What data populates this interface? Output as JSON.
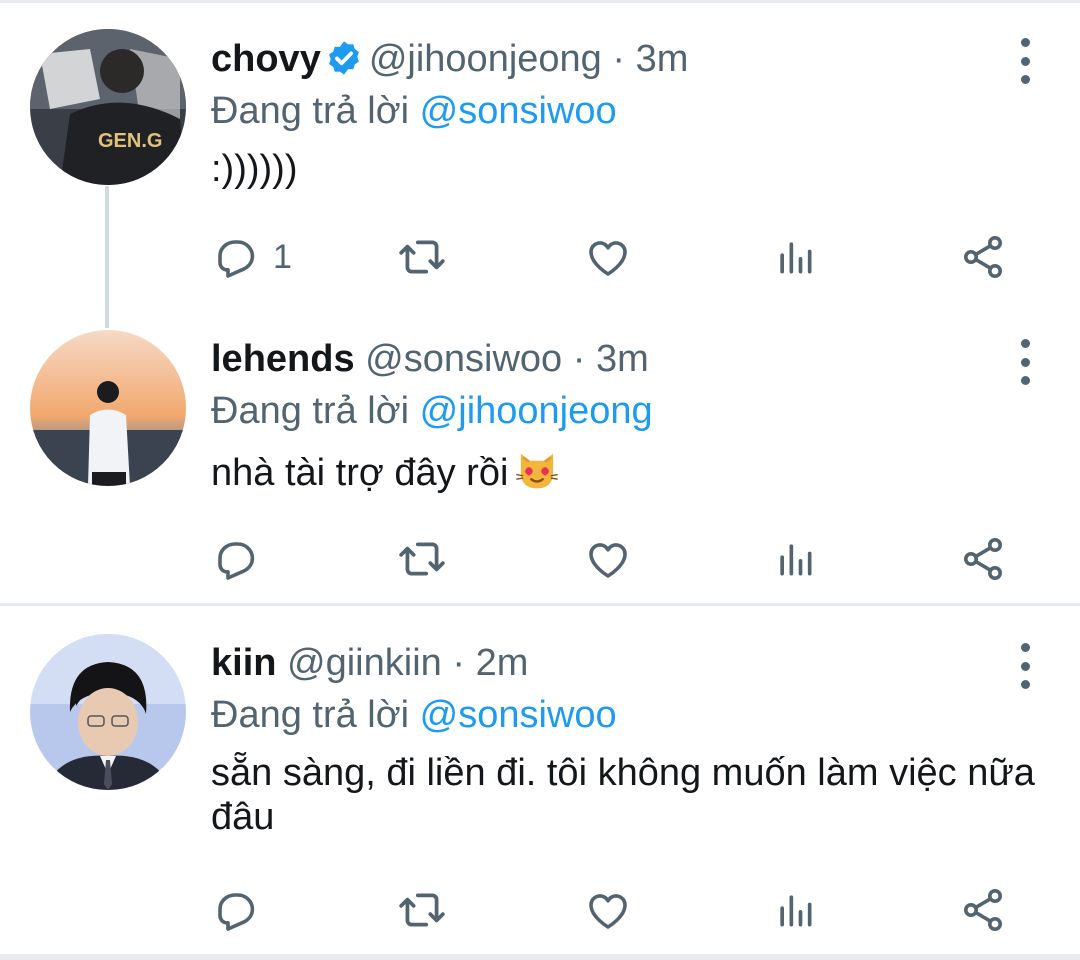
{
  "tweets": [
    {
      "name": "chovy",
      "verified": true,
      "handle": "@jihoonjeong",
      "separator": "·",
      "time": "3m",
      "reply_prefix": "Đang trả lời",
      "reply_to": "@sonsiwoo",
      "text": ":))))))",
      "reply_count": "1",
      "avatar_text": "GEN.G"
    },
    {
      "name": "lehends",
      "verified": false,
      "handle": "@sonsiwoo",
      "separator": "·",
      "time": "3m",
      "reply_prefix": "Đang trả lời",
      "reply_to": "@jihoonjeong",
      "text": "nhà tài trợ đây rồi",
      "emoji": "heart-eyes-cat",
      "reply_count": ""
    },
    {
      "name": "kiin",
      "verified": false,
      "handle": "@giinkiin",
      "separator": "·",
      "time": "2m",
      "reply_prefix": "Đang trả lời",
      "reply_to": "@sonsiwoo",
      "text": "sẵn sàng, đi liền đi. tôi không muốn làm việc nữa đâu",
      "reply_count": ""
    }
  ],
  "icons": {
    "reply": "reply-icon",
    "retweet": "retweet-icon",
    "like": "like-icon",
    "analytics": "analytics-icon",
    "share": "share-icon",
    "more": "more-icon",
    "verified": "verified-badge-icon"
  },
  "colors": {
    "accent": "#1d9bf0",
    "secondary_text": "#536471",
    "divider": "#e6ecf0"
  }
}
